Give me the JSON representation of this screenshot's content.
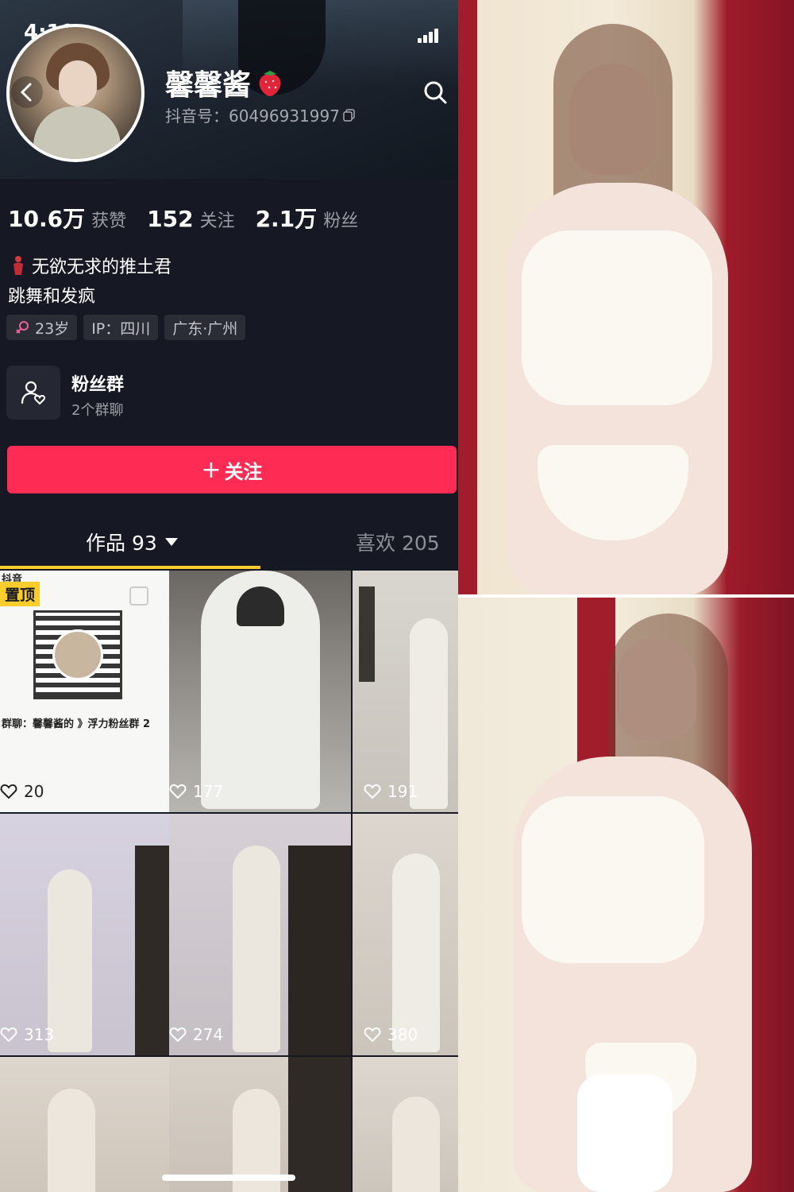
{
  "status_bar": {
    "time": "4:19"
  },
  "profile": {
    "name": "馨馨酱",
    "douyin_id": "抖音号：60496931997",
    "stats": [
      {
        "value": "10.6万",
        "label": "获赞"
      },
      {
        "value": "152",
        "label": "关注"
      },
      {
        "value": "2.1万",
        "label": "粉丝"
      }
    ],
    "bio_line1": "无欲无求的推土君",
    "bio_line2": "跳舞和发疯",
    "tags": [
      "23岁",
      "IP：四川",
      "广东·广州"
    ]
  },
  "fan_group": {
    "title": "粉丝群",
    "subtitle": "2个群聊"
  },
  "follow_button": {
    "label": "关注"
  },
  "tabs": {
    "works": "作品 93",
    "likes": "喜欢 205"
  },
  "videos": [
    {
      "likes": "20",
      "pinned": "置顶",
      "douyin": "抖音",
      "caption": "群聊：馨馨酱的 》浮力粉丝群 2"
    },
    {
      "likes": "177"
    },
    {
      "likes": "191"
    },
    {
      "likes": "313"
    },
    {
      "likes": "274"
    },
    {
      "likes": "380"
    },
    {
      "likes": ""
    },
    {
      "likes": ""
    },
    {
      "likes": ""
    }
  ],
  "colors": {
    "background": "#161823",
    "accent": "#fe2c55",
    "tab_indicator": "#facc2c"
  },
  "icons": [
    "back-icon",
    "search-icon",
    "strawberry-icon",
    "copy-icon",
    "female-icon",
    "fan-group-icon",
    "plus-icon",
    "caret-down-icon",
    "heart-icon"
  ]
}
